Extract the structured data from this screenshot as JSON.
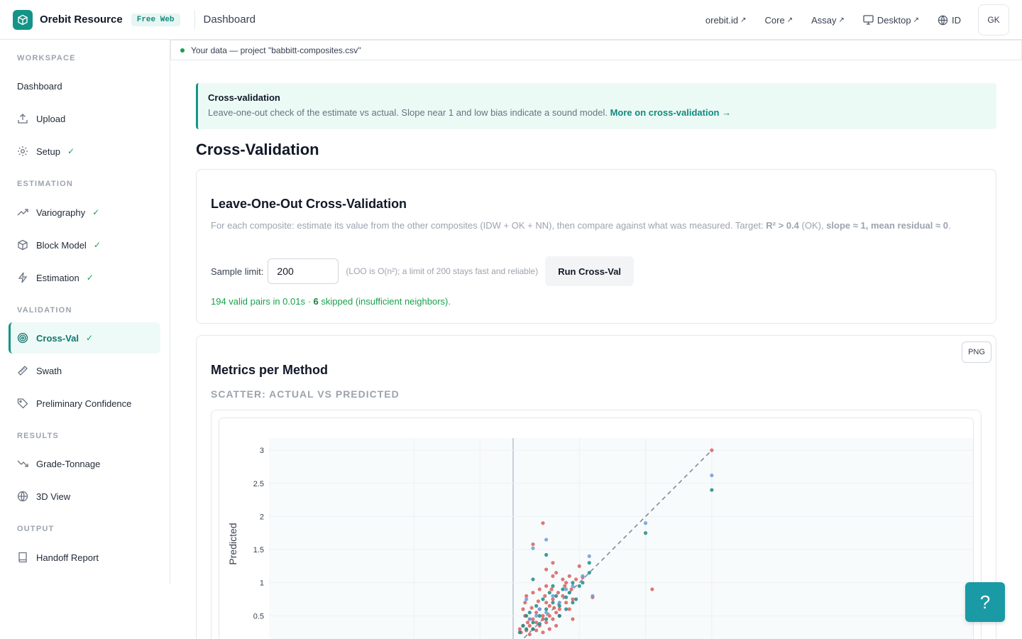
{
  "header": {
    "brand_name": "Orebit Resource",
    "badge": "Free Web",
    "page": "Dashboard",
    "links": [
      {
        "label": "orebit.id",
        "arrow": "↗"
      },
      {
        "label": "Core",
        "arrow": "↗"
      },
      {
        "label": "Assay",
        "arrow": "↗"
      },
      {
        "label": "Desktop",
        "arrow": "↗"
      }
    ],
    "language": "ID",
    "user_initials": "GK",
    "accent_color": "#149488"
  },
  "sidebar": {
    "sections": [
      {
        "title": "WORKSPACE",
        "items": [
          {
            "label": "Dashboard",
            "icon": "none",
            "done": false
          },
          {
            "label": "Upload",
            "icon": "upload-icon",
            "done": false
          },
          {
            "label": "Setup",
            "icon": "gear-icon",
            "done": true
          }
        ]
      },
      {
        "title": "ESTIMATION",
        "items": [
          {
            "label": "Variography",
            "icon": "trend-up-icon",
            "done": true
          },
          {
            "label": "Block Model",
            "icon": "cube-icon",
            "done": true
          },
          {
            "label": "Estimation",
            "icon": "lightning-icon",
            "done": true
          }
        ]
      },
      {
        "title": "VALIDATION",
        "items": [
          {
            "label": "Cross-Val",
            "icon": "target-icon",
            "done": true,
            "active": true
          },
          {
            "label": "Swath",
            "icon": "ruler-icon",
            "done": false
          },
          {
            "label": "Preliminary Confidence",
            "icon": "tag-icon",
            "done": false
          }
        ]
      },
      {
        "title": "RESULTS",
        "items": [
          {
            "label": "Grade-Tonnage",
            "icon": "trend-down-icon",
            "done": false
          },
          {
            "label": "3D View",
            "icon": "globe-icon",
            "done": false
          }
        ]
      },
      {
        "title": "OUTPUT",
        "items": [
          {
            "label": "Handoff Report",
            "icon": "book-icon",
            "done": false
          }
        ]
      }
    ],
    "check_mark": "✓"
  },
  "data_strip": {
    "text": "Your data — project \"babbitt-composites.csv\""
  },
  "info": {
    "title": "Cross-validation",
    "text": "Leave-one-out check of the estimate vs actual. Slope near 1 and low bias indicate a sound model.",
    "link": "More on cross-validation →"
  },
  "page_title": "Cross-Validation",
  "loo": {
    "title": "Leave-One-Out Cross-Validation",
    "desc_prefix": "For each composite: estimate its value from the other composites (IDW + OK + NN), then compare against what was measured. Target:",
    "target_r2": "R² > 0.4",
    "target_ok": "(OK),",
    "target_rest": "slope ≈ 1, mean residual ≈ 0",
    "desc_end": ".",
    "sample_label": "Sample limit:",
    "sample_value": "200",
    "sample_hint": "(LOO is O(n²); a limit of 200 stays fast and reliable)",
    "run_label": "Run Cross-Val",
    "result_pairs": "194 valid pairs in 0.01s ·",
    "result_skipped_count": "6",
    "result_skipped_text": "skipped (insufficient neighbors)."
  },
  "metrics": {
    "title": "Metrics per Method",
    "png_label": "PNG",
    "scatter_label": "SCATTER: ACTUAL VS PREDICTED"
  },
  "chart_data": {
    "type": "scatter",
    "title": "",
    "xlabel": "",
    "ylabel": "Predicted",
    "y_ticks": [
      "0.5",
      "1",
      "1.5",
      "2",
      "2.5",
      "3"
    ],
    "ylim": [
      0.2,
      3.1
    ],
    "xlim": [
      -1.95,
      3.75
    ],
    "reference_line": {
      "from": [
        0,
        0
      ],
      "to": [
        3,
        3
      ]
    },
    "series": [
      {
        "color": "#d95f5f",
        "points": [
          [
            3.0,
            3.0
          ],
          [
            2.1,
            0.9
          ],
          [
            0.45,
            1.9
          ],
          [
            0.3,
            1.58
          ],
          [
            0.5,
            1.2
          ],
          [
            0.6,
            1.1
          ],
          [
            0.65,
            1.15
          ],
          [
            0.75,
            1.05
          ],
          [
            0.8,
            1.0
          ],
          [
            0.85,
            1.1
          ],
          [
            0.95,
            1.05
          ],
          [
            1.05,
            1.08
          ],
          [
            1.2,
            0.78
          ],
          [
            0.18,
            0.5
          ],
          [
            0.22,
            0.4
          ],
          [
            0.25,
            0.35
          ],
          [
            0.3,
            0.45
          ],
          [
            0.35,
            0.55
          ],
          [
            0.4,
            0.6
          ],
          [
            0.45,
            0.5
          ],
          [
            0.5,
            0.7
          ],
          [
            0.55,
            0.65
          ],
          [
            0.6,
            0.75
          ],
          [
            0.65,
            0.55
          ],
          [
            0.7,
            0.6
          ],
          [
            0.75,
            0.8
          ],
          [
            0.1,
            0.3
          ],
          [
            0.12,
            0.25
          ],
          [
            0.15,
            0.35
          ],
          [
            0.2,
            0.28
          ],
          [
            0.25,
            0.22
          ],
          [
            0.3,
            0.3
          ],
          [
            0.35,
            0.4
          ],
          [
            0.4,
            0.35
          ],
          [
            0.45,
            0.45
          ],
          [
            0.5,
            0.4
          ],
          [
            0.55,
            0.5
          ],
          [
            0.6,
            0.45
          ],
          [
            0.65,
            0.35
          ],
          [
            0.7,
            0.5
          ],
          [
            0.8,
            0.7
          ],
          [
            0.85,
            0.6
          ],
          [
            0.9,
            0.75
          ],
          [
            0.2,
            0.8
          ],
          [
            0.3,
            0.85
          ],
          [
            0.4,
            0.9
          ],
          [
            0.5,
            0.95
          ],
          [
            0.15,
            0.6
          ],
          [
            0.18,
            0.7
          ],
          [
            0.28,
            0.62
          ],
          [
            0.38,
            0.72
          ],
          [
            0.48,
            0.8
          ],
          [
            0.58,
            0.9
          ],
          [
            0.68,
            0.85
          ],
          [
            0.78,
            0.95
          ],
          [
            0.88,
            0.9
          ],
          [
            1.0,
            1.25
          ],
          [
            0.6,
            1.3
          ],
          [
            0.55,
            0.3
          ],
          [
            0.45,
            0.25
          ],
          [
            0.35,
            0.28
          ],
          [
            0.25,
            0.45
          ],
          [
            0.9,
            0.45
          ],
          [
            0.62,
            0.62
          ]
        ]
      },
      {
        "color": "#6b9bdc",
        "points": [
          [
            3.0,
            2.62
          ],
          [
            2.0,
            1.9
          ],
          [
            0.5,
            1.65
          ],
          [
            0.3,
            1.52
          ],
          [
            1.15,
            1.4
          ],
          [
            1.2,
            0.8
          ],
          [
            0.2,
            0.75
          ],
          [
            0.4,
            0.6
          ],
          [
            0.6,
            0.8
          ],
          [
            0.8,
            0.9
          ],
          [
            0.25,
            0.45
          ],
          [
            0.35,
            0.5
          ],
          [
            0.5,
            0.55
          ],
          [
            0.7,
            0.7
          ],
          [
            0.9,
            0.95
          ],
          [
            1.05,
            1.1
          ]
        ]
      },
      {
        "color": "#1f8a8a",
        "points": [
          [
            3.0,
            2.4
          ],
          [
            2.0,
            1.75
          ],
          [
            0.5,
            1.42
          ],
          [
            1.15,
            1.3
          ],
          [
            1.15,
            1.15
          ],
          [
            0.3,
            1.05
          ],
          [
            0.9,
            1.0
          ],
          [
            1.0,
            0.95
          ],
          [
            0.75,
            0.9
          ],
          [
            0.6,
            0.7
          ],
          [
            0.5,
            0.6
          ],
          [
            0.4,
            0.5
          ],
          [
            0.3,
            0.4
          ],
          [
            0.2,
            0.3
          ],
          [
            0.15,
            0.35
          ],
          [
            0.25,
            0.55
          ],
          [
            0.35,
            0.65
          ],
          [
            0.45,
            0.75
          ],
          [
            0.55,
            0.85
          ],
          [
            0.65,
            0.8
          ],
          [
            0.85,
            0.85
          ],
          [
            0.95,
            0.75
          ],
          [
            1.05,
            1.0
          ],
          [
            0.7,
            0.5
          ],
          [
            0.8,
            0.6
          ],
          [
            0.9,
            0.7
          ],
          [
            0.3,
            0.3
          ],
          [
            0.4,
            0.38
          ],
          [
            0.1,
            0.25
          ],
          [
            0.6,
            0.95
          ],
          [
            0.2,
            0.5
          ],
          [
            0.5,
            0.45
          ],
          [
            0.7,
            0.65
          ],
          [
            0.8,
            0.78
          ]
        ]
      }
    ]
  },
  "help": {
    "label": "?"
  }
}
